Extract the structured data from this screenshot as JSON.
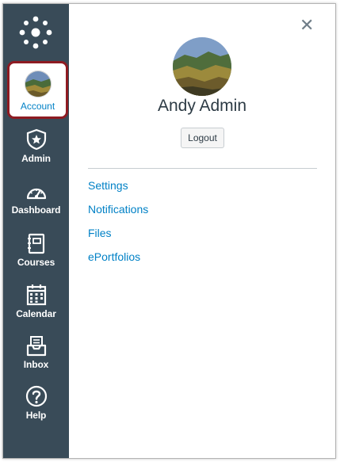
{
  "colors": {
    "sidebar_bg": "#394b58",
    "accent_link": "#0081c6",
    "active_border": "#8e1b22"
  },
  "sidebar": {
    "logo_icon": "canvas-logo-icon",
    "items": [
      {
        "label": "Account",
        "icon": "avatar",
        "active": true
      },
      {
        "label": "Admin",
        "icon": "admin-shield-icon"
      },
      {
        "label": "Dashboard",
        "icon": "dashboard-gauge-icon"
      },
      {
        "label": "Courses",
        "icon": "courses-book-icon"
      },
      {
        "label": "Calendar",
        "icon": "calendar-icon"
      },
      {
        "label": "Inbox",
        "icon": "inbox-tray-icon"
      },
      {
        "label": "Help",
        "icon": "help-question-icon"
      }
    ]
  },
  "tray": {
    "close_icon": "close-icon",
    "user_name": "Andy Admin",
    "logout_label": "Logout",
    "links": [
      "Settings",
      "Notifications",
      "Files",
      "ePortfolios"
    ]
  }
}
